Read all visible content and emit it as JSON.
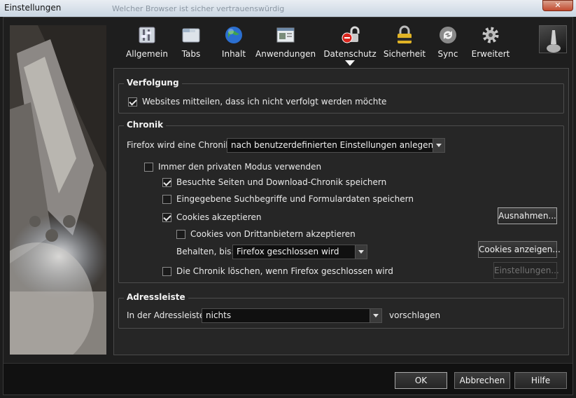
{
  "window": {
    "title": "Einstellungen",
    "ghost_text": "Welcher Browser ist sicher vertrauenswürdig"
  },
  "toolbar": {
    "tabs": [
      {
        "label": "Allgemein",
        "icon": "general-icon"
      },
      {
        "label": "Tabs",
        "icon": "tabs-icon"
      },
      {
        "label": "Inhalt",
        "icon": "content-globe-icon"
      },
      {
        "label": "Anwendungen",
        "icon": "applications-icon"
      },
      {
        "label": "Datenschutz",
        "icon": "privacy-icon"
      },
      {
        "label": "Sicherheit",
        "icon": "security-lock-icon"
      },
      {
        "label": "Sync",
        "icon": "sync-icon"
      },
      {
        "label": "Erweitert",
        "icon": "gear-icon"
      }
    ],
    "selected": "Datenschutz"
  },
  "verfolgung": {
    "heading": "Verfolgung",
    "dnt_label": "Websites mitteilen, dass ich nicht verfolgt werden möchte",
    "dnt_checked": true
  },
  "chronik": {
    "heading": "Chronik",
    "mode_label": "Firefox wird eine Chronik:",
    "mode_value": "nach benutzerdefinierten Einstellungen anlegen",
    "private_label": "Immer den privaten Modus verwenden",
    "private_checked": false,
    "history_label": "Besuchte Seiten und Download-Chronik speichern",
    "history_checked": true,
    "forms_label": "Eingegebene Suchbegriffe und Formulardaten speichern",
    "forms_checked": false,
    "cookies_label": "Cookies akzeptieren",
    "cookies_checked": true,
    "exceptions_button": "Ausnahmen...",
    "thirdparty_label": "Cookies von Drittanbietern akzeptieren",
    "thirdparty_checked": false,
    "keep_label": "Behalten, bis:",
    "keep_value": "Firefox geschlossen wird",
    "show_cookies_button": "Cookies anzeigen...",
    "clear_label": "Die Chronik löschen, wenn Firefox geschlossen wird",
    "clear_checked": false,
    "settings_button": "Einstellungen..."
  },
  "adressleiste": {
    "heading": "Adressleiste",
    "prefix_label": "In der Adressleiste",
    "value": "nichts",
    "suffix_label": "vorschlagen"
  },
  "buttons": {
    "ok": "OK",
    "cancel": "Abbrechen",
    "help": "Hilfe"
  },
  "colors": {
    "background": "#1e1e1e",
    "panel": "#262626",
    "titlebar": "#dce5ee",
    "close": "#c24b2f"
  }
}
